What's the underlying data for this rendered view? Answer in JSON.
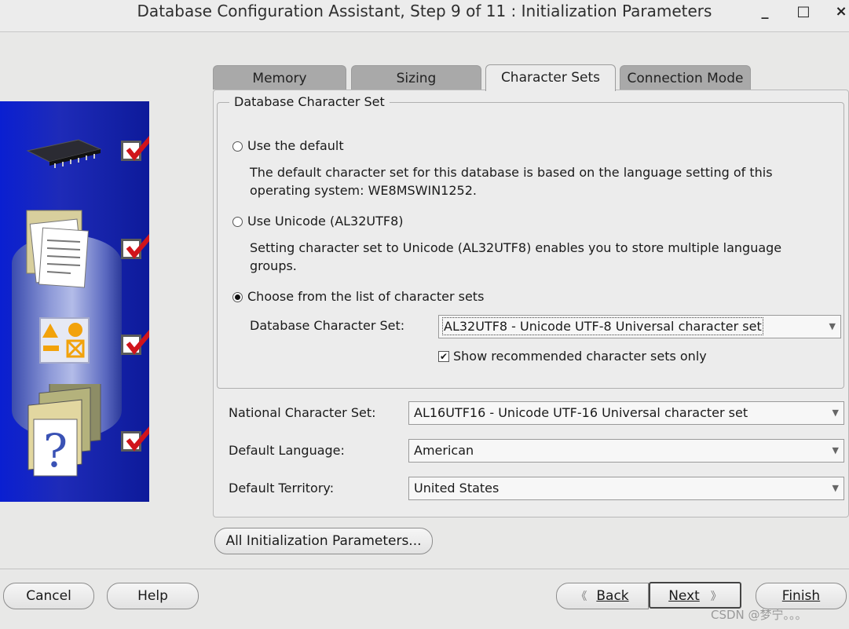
{
  "window": {
    "title": "Database Configuration Assistant, Step 9 of 11 : Initialization Parameters",
    "min_glyph": "_",
    "max_glyph": "□",
    "close_glyph": "×"
  },
  "tabs": [
    {
      "label": "Memory",
      "active": false
    },
    {
      "label": "Sizing",
      "active": false
    },
    {
      "label": "Character Sets",
      "active": true
    },
    {
      "label": "Connection Mode",
      "active": false
    }
  ],
  "db_charset": {
    "legend": "Database Character Set",
    "option_default": {
      "label": "Use the default",
      "selected": false,
      "desc_line1": "The default character set for this database is based on the language setting of this",
      "desc_line2": "operating system: WE8MSWIN1252."
    },
    "option_unicode": {
      "label": "Use Unicode (AL32UTF8)",
      "selected": false,
      "desc_line1": "Setting character set to Unicode (AL32UTF8) enables you to store multiple language",
      "desc_line2": "groups."
    },
    "option_choose": {
      "label": "Choose from the list of character sets",
      "selected": true
    },
    "select_label": "Database Character Set:",
    "select_value": "AL32UTF8 - Unicode UTF-8 Universal character set",
    "recommended_checkbox": {
      "label": "Show recommended character sets only",
      "checked": true,
      "glyph": "✔"
    }
  },
  "national": {
    "label": "National Character Set:",
    "value": "AL16UTF16 - Unicode UTF-16 Universal character set"
  },
  "language": {
    "label": "Default Language:",
    "value": "American"
  },
  "territory": {
    "label": "Default Territory:",
    "value": "United States"
  },
  "dropdown_glyph": "▼",
  "buttons": {
    "all_params": "All Initialization Parameters...",
    "cancel": "Cancel",
    "help": "Help",
    "back": "Back",
    "back_glyph": "《",
    "next": "Next",
    "next_glyph": "》",
    "finish": "Finish"
  },
  "watermark": "CSDN @梦宁。。。",
  "colors": {
    "side_panel": "#0a1fd1",
    "check": "#d0141b",
    "active_tab": "#ececec",
    "inactive_tab": "#a9a9a9"
  }
}
